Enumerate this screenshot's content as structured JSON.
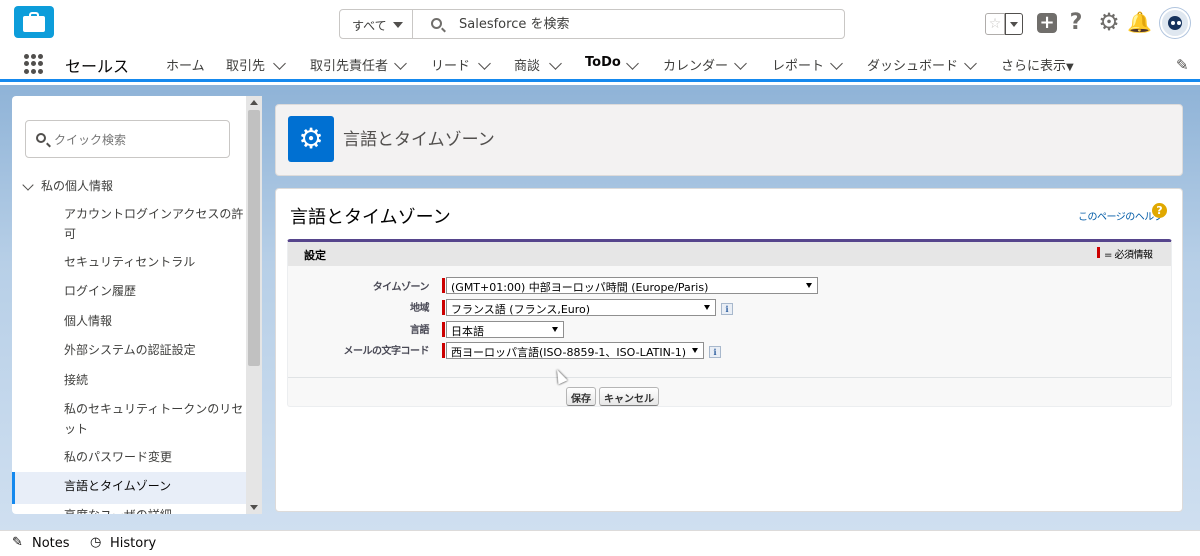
{
  "header": {
    "search_scope": "すべて",
    "search_placeholder": "Salesforce を検索"
  },
  "nav": {
    "app_name": "セールス",
    "items": [
      {
        "label": "ホーム",
        "dropdown": false
      },
      {
        "label": "取引先",
        "dropdown": true
      },
      {
        "label": "取引先責任者",
        "dropdown": true
      },
      {
        "label": "リード",
        "dropdown": true
      },
      {
        "label": "商談",
        "dropdown": true
      },
      {
        "label": "ToDo",
        "dropdown": true
      },
      {
        "label": "カレンダー",
        "dropdown": true
      },
      {
        "label": "レポート",
        "dropdown": true
      },
      {
        "label": "ダッシュボード",
        "dropdown": true
      },
      {
        "label": "さらに表示",
        "dropdown": true
      }
    ]
  },
  "sidebar": {
    "quick_search_placeholder": "クイック検索",
    "section_label": "私の個人情報",
    "items": [
      "アカウントログインアクセスの許可",
      "セキュリティセントラル",
      "ログイン履歴",
      "個人情報",
      "外部システムの認証設定",
      "接続",
      "私のセキュリティトークンのリセット",
      "私のパスワード変更",
      "言語とタイムゾーン",
      "高度なユーザの詳細"
    ],
    "active_item": "言語とタイムゾーン"
  },
  "page_header": {
    "title": "言語とタイムゾーン"
  },
  "main": {
    "title": "言語とタイムゾーン",
    "help_link": "このページのヘルプ",
    "section_label": "設定",
    "required_legend": "= 必須情報",
    "fields": [
      {
        "label": "タイムゾーン",
        "value": "(GMT+01:00) 中部ヨーロッパ時間 (Europe/Paris)"
      },
      {
        "label": "地域",
        "value": "フランス語 (フランス,Euro)"
      },
      {
        "label": "言語",
        "value": "日本語"
      },
      {
        "label": "メールの文字コード",
        "value": "西ヨーロッパ言語(ISO-8859-1、ISO-LATIN-1)"
      }
    ],
    "save_button": "保存",
    "cancel_button": "キャンセル"
  },
  "utility_bar": {
    "notes": "Notes",
    "history": "History"
  },
  "colors": {
    "brand_blue": "#0070d2",
    "accent_blue": "#1589ee",
    "required_red": "#cc0000",
    "section_purple": "#56458c"
  }
}
